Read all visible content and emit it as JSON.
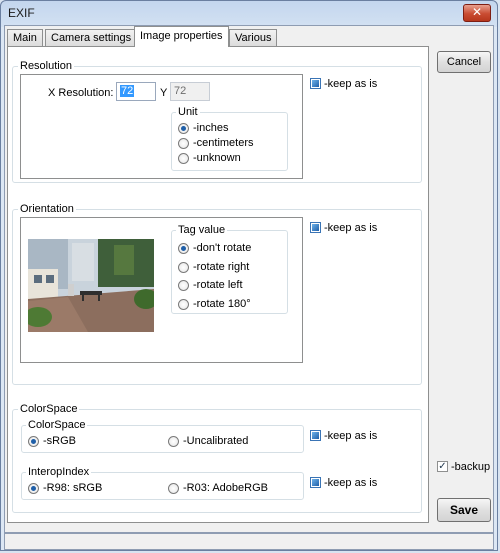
{
  "window": {
    "title": "EXIF",
    "close_glyph": "✕"
  },
  "tabs": [
    {
      "label": "Main"
    },
    {
      "label": "Camera settings"
    },
    {
      "label": "Image properties",
      "active": true
    },
    {
      "label": "Various"
    }
  ],
  "resolution": {
    "legend": "Resolution",
    "x_label": "X Resolution:",
    "x_value": "72",
    "y_label": "Y",
    "y_value": "72",
    "keep_label": "-keep as is",
    "unit": {
      "legend": "Unit",
      "options": [
        "-inches",
        "-centimeters",
        "-unknown"
      ],
      "selected_index": 0
    }
  },
  "orientation": {
    "legend": "Orientation",
    "keep_label": "-keep as is",
    "tag_value": {
      "legend": "Tag value",
      "options": [
        "-don't rotate",
        "-rotate right",
        "-rotate left",
        "-rotate 180°"
      ],
      "selected_index": 0
    }
  },
  "colorspace": {
    "legend": "ColorSpace",
    "inner": {
      "legend": "ColorSpace",
      "options": [
        "-sRGB",
        "-Uncalibrated"
      ],
      "selected_index": 0,
      "keep_label": "-keep as is"
    },
    "interop": {
      "legend": "InteropIndex",
      "options": [
        "-R98: sRGB",
        "-R03: AdobeRGB"
      ],
      "selected_index": 0,
      "keep_label": "-keep as is"
    }
  },
  "buttons": {
    "cancel": "Cancel",
    "save": "Save"
  },
  "backup": {
    "label": "-backup",
    "checked": true,
    "check_glyph": "✓"
  },
  "colors": {
    "selection": "#3399ff",
    "radio_dot": "#1f5fa8",
    "check_fill": "#1f5fa8"
  }
}
